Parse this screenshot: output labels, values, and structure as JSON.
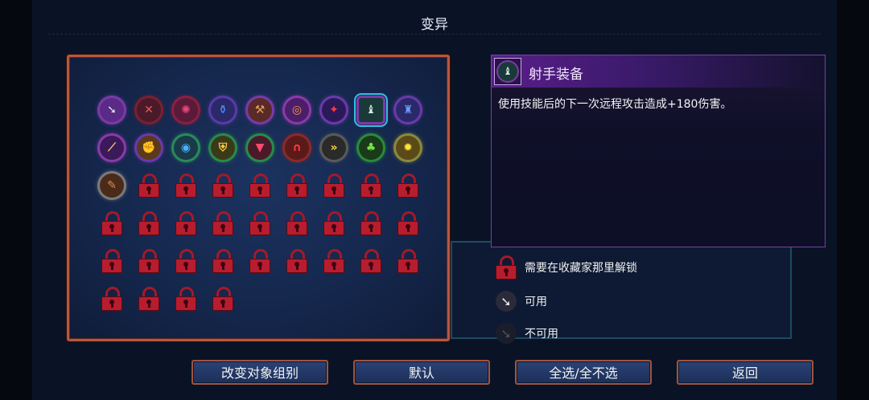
{
  "header": {
    "title": "变异"
  },
  "grid": {
    "cells": [
      {
        "kind": "icon",
        "name": "sword-icon",
        "bg": "#5a2a86",
        "ring": "#7a3aa8",
        "fg": "#dfe6ee",
        "glyph": "➘"
      },
      {
        "kind": "icon",
        "name": "crossbow-icon",
        "bg": "#4a1a2a",
        "ring": "#7a2030",
        "fg": "#e05a5a",
        "glyph": "✕"
      },
      {
        "kind": "icon",
        "name": "claw-icon",
        "bg": "#5a1a3a",
        "ring": "#8a2040",
        "fg": "#e04a7a",
        "glyph": "✺"
      },
      {
        "kind": "icon",
        "name": "potion-icon",
        "bg": "#2a2a6a",
        "ring": "#5a3aa8",
        "fg": "#4a9aff",
        "glyph": "⚱"
      },
      {
        "kind": "icon",
        "name": "hammer-icon",
        "bg": "#5a2a26",
        "ring": "#7a3aa8",
        "fg": "#e0a060",
        "glyph": "⚒"
      },
      {
        "kind": "icon",
        "name": "ring-icon",
        "bg": "#4a1e6a",
        "ring": "#8a3aa8",
        "fg": "#ff9a3a",
        "glyph": "◎"
      },
      {
        "kind": "icon",
        "name": "star-cross-icon",
        "bg": "#2a1a5a",
        "ring": "#6a3aa8",
        "fg": "#ff3a3a",
        "glyph": "✦"
      },
      {
        "kind": "icon",
        "name": "archer-gear-icon",
        "bg": "#1a3a3a",
        "ring": "#7a3aa8",
        "fg": "#cfe8e0",
        "glyph": "♝",
        "selected": true
      },
      {
        "kind": "icon",
        "name": "helmet-icon",
        "bg": "#2a2a6a",
        "ring": "#6a3aa8",
        "fg": "#6a9aff",
        "glyph": "♜"
      },
      {
        "kind": "icon",
        "name": "spear-icon",
        "bg": "#3a1a5a",
        "ring": "#8a3aa8",
        "fg": "#ffcc66",
        "glyph": "⟋"
      },
      {
        "kind": "icon",
        "name": "fist-icon",
        "bg": "#5a3a1a",
        "ring": "#6a3aa8",
        "fg": "#ffb04a",
        "glyph": "✊"
      },
      {
        "kind": "icon",
        "name": "eye-icon",
        "bg": "#1a3a4a",
        "ring": "#2a8a5a",
        "fg": "#4ab0ff",
        "glyph": "◉"
      },
      {
        "kind": "icon",
        "name": "shield-icon",
        "bg": "#3a3a1a",
        "ring": "#2a8a4a",
        "fg": "#ffcc3a",
        "glyph": "⛨"
      },
      {
        "kind": "icon",
        "name": "fangs-icon",
        "bg": "#4a1a2a",
        "ring": "#2a8a4a",
        "fg": "#ff4a6a",
        "glyph": "▼"
      },
      {
        "kind": "icon",
        "name": "magnet-icon",
        "bg": "#5a1a1a",
        "ring": "#8a2a2a",
        "fg": "#ff3a3a",
        "glyph": "∩"
      },
      {
        "kind": "icon",
        "name": "fast-forward-icon",
        "bg": "#2a2a2a",
        "ring": "#5a5a5a",
        "fg": "#ffd23a",
        "glyph": "»"
      },
      {
        "kind": "icon",
        "name": "tree-icon",
        "bg": "#1a3a1a",
        "ring": "#2a8a3a",
        "fg": "#7ae04a",
        "glyph": "♣"
      },
      {
        "kind": "icon",
        "name": "sun-icon",
        "bg": "#5a4a1a",
        "ring": "#8a8a3a",
        "fg": "#ffe23a",
        "glyph": "✹"
      },
      {
        "kind": "icon",
        "name": "scroll-icon",
        "bg": "#4a2a1a",
        "ring": "#7a7a7a",
        "fg": "#e08a4a",
        "glyph": "✎"
      },
      {
        "kind": "lock"
      },
      {
        "kind": "lock"
      },
      {
        "kind": "lock"
      },
      {
        "kind": "lock"
      },
      {
        "kind": "lock"
      },
      {
        "kind": "lock"
      },
      {
        "kind": "lock"
      },
      {
        "kind": "lock"
      },
      {
        "kind": "lock"
      },
      {
        "kind": "lock"
      },
      {
        "kind": "lock"
      },
      {
        "kind": "lock"
      },
      {
        "kind": "lock"
      },
      {
        "kind": "lock"
      },
      {
        "kind": "lock"
      },
      {
        "kind": "lock"
      },
      {
        "kind": "lock"
      },
      {
        "kind": "lock"
      },
      {
        "kind": "lock"
      },
      {
        "kind": "lock"
      },
      {
        "kind": "lock"
      },
      {
        "kind": "lock"
      },
      {
        "kind": "lock"
      },
      {
        "kind": "lock"
      },
      {
        "kind": "lock"
      },
      {
        "kind": "lock"
      },
      {
        "kind": "lock"
      },
      {
        "kind": "lock"
      },
      {
        "kind": "lock"
      },
      {
        "kind": "lock"
      }
    ]
  },
  "detail": {
    "name": "射手装备",
    "description": "使用技能后的下一次远程攻击造成+180伤害。",
    "icon": "archer-gear-icon"
  },
  "legend": {
    "locked": "需要在收藏家那里解锁",
    "available": "可用",
    "unavailable": "不可用"
  },
  "buttons": {
    "change_group": "改变对象组别",
    "default": "默认",
    "select_all": "全选/全不选",
    "back": "返回"
  },
  "colors": {
    "panel_border": "#b9563e",
    "detail_border": "#7a3fa8",
    "selection": "#2fc0e0",
    "lock": "#b71d2e"
  }
}
